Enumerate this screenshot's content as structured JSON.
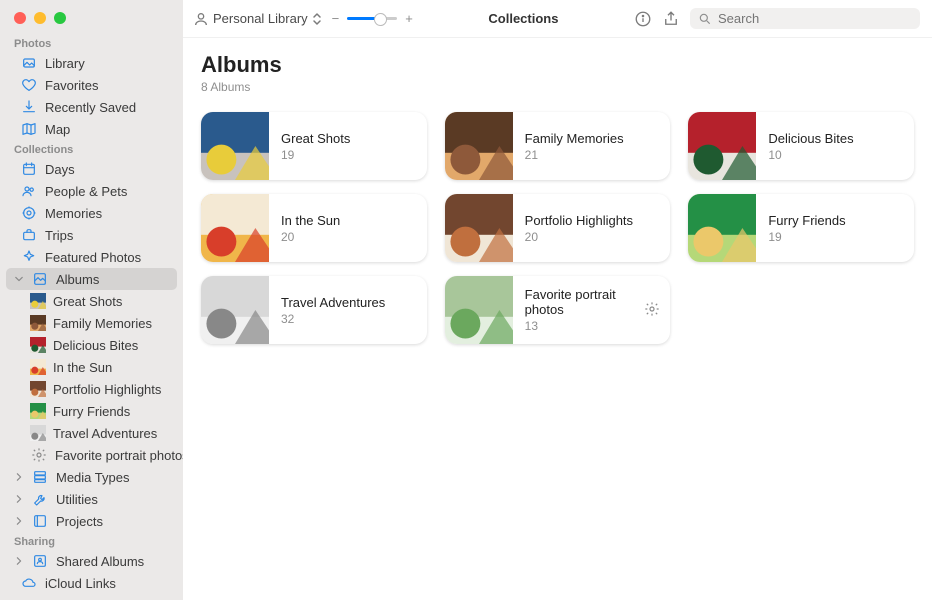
{
  "toolbar": {
    "library_select": "Personal Library",
    "collections_title": "Collections",
    "search_placeholder": "Search"
  },
  "sidebar": {
    "sections": [
      {
        "header": "Photos",
        "items": [
          {
            "label": "Library",
            "icon": "photo-stack"
          },
          {
            "label": "Favorites",
            "icon": "heart"
          },
          {
            "label": "Recently Saved",
            "icon": "download"
          },
          {
            "label": "Map",
            "icon": "map"
          }
        ]
      },
      {
        "header": "Collections",
        "items": [
          {
            "label": "Days",
            "icon": "calendar"
          },
          {
            "label": "People & Pets",
            "icon": "people"
          },
          {
            "label": "Memories",
            "icon": "memories"
          },
          {
            "label": "Trips",
            "icon": "suitcase"
          },
          {
            "label": "Featured Photos",
            "icon": "sparkle"
          },
          {
            "label": "Albums",
            "icon": "album",
            "selected": true,
            "expandable": true,
            "expanded": true,
            "children": [
              {
                "label": "Great Shots",
                "thumb": "t0"
              },
              {
                "label": "Family Memories",
                "thumb": "t1"
              },
              {
                "label": "Delicious Bites",
                "thumb": "t2"
              },
              {
                "label": "In the Sun",
                "thumb": "t3"
              },
              {
                "label": "Portfolio Highlights",
                "thumb": "t4"
              },
              {
                "label": "Furry Friends",
                "thumb": "t5"
              },
              {
                "label": "Travel Adventures",
                "thumb": "t6"
              },
              {
                "label": "Favorite portrait photos",
                "thumb": "gear"
              }
            ]
          },
          {
            "label": "Media Types",
            "icon": "stack",
            "expandable": true
          },
          {
            "label": "Utilities",
            "icon": "wrench",
            "expandable": true
          },
          {
            "label": "Projects",
            "icon": "projects",
            "expandable": true
          }
        ]
      },
      {
        "header": "Sharing",
        "items": [
          {
            "label": "Shared Albums",
            "icon": "shared-album",
            "expandable": true
          },
          {
            "label": "iCloud Links",
            "icon": "cloud-link"
          }
        ]
      }
    ]
  },
  "main": {
    "title": "Albums",
    "subtitle": "8 Albums",
    "albums": [
      {
        "name": "Great Shots",
        "count": "19",
        "thumb": "t0"
      },
      {
        "name": "Family Memories",
        "count": "21",
        "thumb": "t1"
      },
      {
        "name": "Delicious Bites",
        "count": "10",
        "thumb": "t2"
      },
      {
        "name": "In the Sun",
        "count": "20",
        "thumb": "t3"
      },
      {
        "name": "Portfolio Highlights",
        "count": "20",
        "thumb": "t4"
      },
      {
        "name": "Furry Friends",
        "count": "19",
        "thumb": "t5"
      },
      {
        "name": "Travel Adventures",
        "count": "32",
        "thumb": "t6"
      },
      {
        "name": "Favorite portrait photos",
        "count": "13",
        "thumb": "t7",
        "badge": "gear"
      }
    ]
  },
  "thumbs": {
    "t0": [
      "#2a5a8d",
      "#e8cc3a",
      "#c8c2bd"
    ],
    "t1": [
      "#5a3a24",
      "#8e593a",
      "#e2a86a"
    ],
    "t2": [
      "#b5212c",
      "#1f5a30",
      "#e8e5de"
    ],
    "t3": [
      "#f4e9d4",
      "#d83e2a",
      "#f0b64a"
    ],
    "t4": [
      "#72462f",
      "#c06f3e",
      "#f0e6d6"
    ],
    "t5": [
      "#249046",
      "#ebc86a",
      "#b5d878"
    ],
    "t6": [
      "#d8d8d8",
      "#888888",
      "#f0f0f0"
    ],
    "t7": [
      "#a8c69a",
      "#6ba85e",
      "#e3efdf"
    ]
  }
}
